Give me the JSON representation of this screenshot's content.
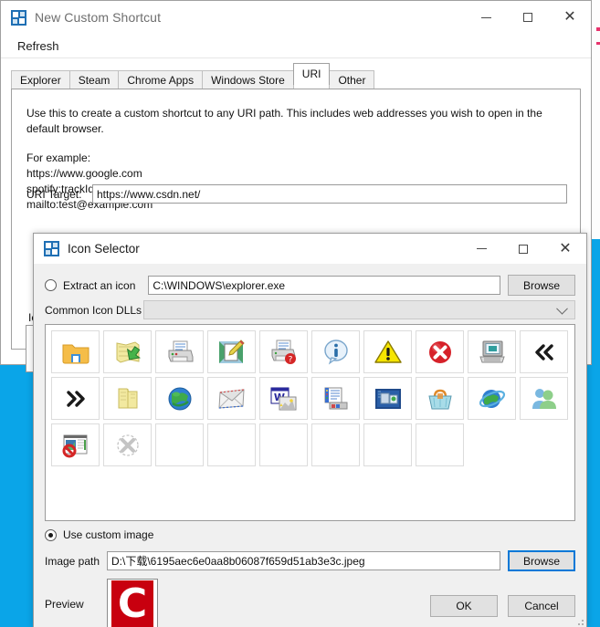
{
  "desktop": {
    "background_color": "#0aa5e8"
  },
  "main_window": {
    "title": "New Custom Shortcut",
    "app_icon": "app-puzzle-icon",
    "controls": {
      "minimize": "—",
      "maximize": "☐",
      "close": "✕"
    },
    "menu": [
      {
        "label": "Refresh"
      }
    ],
    "tabs": [
      {
        "label": "Explorer",
        "active": false
      },
      {
        "label": "Steam",
        "active": false
      },
      {
        "label": "Chrome Apps",
        "active": false
      },
      {
        "label": "Windows Store",
        "active": false
      },
      {
        "label": "URI",
        "active": true
      },
      {
        "label": "Other",
        "active": false
      }
    ],
    "uri_tab": {
      "description": "Use this to create a custom shortcut to any URI path. This includes web addresses you wish to open in the default browser.",
      "examples_heading": "For example:",
      "examples": [
        "https://www.google.com",
        "spotify:trackId",
        "mailto:test@example.com"
      ],
      "uri_target_label": "URI Target:",
      "uri_target_value": "https://www.csdn.net/",
      "uri_target_placeholder": "",
      "icon_label": "Icon"
    }
  },
  "icon_selector": {
    "title": "Icon Selector",
    "app_icon": "app-puzzle-icon",
    "controls": {
      "minimize": "—",
      "maximize": "☐",
      "close": "✕"
    },
    "extract": {
      "radio_label": "Extract an icon",
      "selected": false,
      "path_value": "C:\\WINDOWS\\explorer.exe",
      "path_placeholder": "",
      "browse_label": "Browse"
    },
    "common_dlls": {
      "label": "Common Icon DLLs",
      "selected_value": "",
      "placeholder": ""
    },
    "icon_grid": {
      "columns": 10,
      "rows": 3,
      "cells": [
        {
          "name": "folder-icon",
          "filled": true
        },
        {
          "name": "map-arrow-icon",
          "filled": true
        },
        {
          "name": "printer-icon",
          "filled": true
        },
        {
          "name": "edit-document-icon",
          "filled": true
        },
        {
          "name": "printer-help-icon",
          "filled": true
        },
        {
          "name": "information-balloon-icon",
          "filled": true
        },
        {
          "name": "warning-triangle-icon",
          "filled": true
        },
        {
          "name": "error-cross-icon",
          "filled": true
        },
        {
          "name": "computer-icon",
          "filled": true
        },
        {
          "name": "double-chevron-left-icon",
          "filled": true
        },
        {
          "name": "double-chevron-right-icon",
          "filled": true
        },
        {
          "name": "open-folder-icon",
          "filled": true
        },
        {
          "name": "globe-icon",
          "filled": true
        },
        {
          "name": "mail-envelope-icon",
          "filled": true
        },
        {
          "name": "word-document-icon",
          "filled": true
        },
        {
          "name": "server-list-icon",
          "filled": true
        },
        {
          "name": "network-card-icon",
          "filled": true
        },
        {
          "name": "shopping-basket-icon",
          "filled": true
        },
        {
          "name": "internet-globe-icon",
          "filled": true
        },
        {
          "name": "users-group-icon",
          "filled": true
        },
        {
          "name": "blocked-window-icon",
          "filled": true
        },
        {
          "name": "disabled-cross-icon",
          "filled": true
        },
        {
          "name": "empty-cell",
          "filled": false
        },
        {
          "name": "empty-cell",
          "filled": false
        },
        {
          "name": "empty-cell",
          "filled": false
        },
        {
          "name": "empty-cell",
          "filled": false
        },
        {
          "name": "empty-cell",
          "filled": false
        },
        {
          "name": "empty-cell",
          "filled": false
        }
      ]
    },
    "custom_image": {
      "radio_label": "Use custom image",
      "selected": true,
      "path_label": "Image path",
      "path_value": "D:\\下载\\6195aec6e0aa8b06087f659d51ab3e3c.jpeg",
      "path_placeholder": "",
      "browse_label": "Browse"
    },
    "preview": {
      "label": "Preview",
      "logo_text": "C",
      "logo_color": "#c8000f"
    },
    "buttons": {
      "ok": "OK",
      "cancel": "Cancel"
    }
  }
}
